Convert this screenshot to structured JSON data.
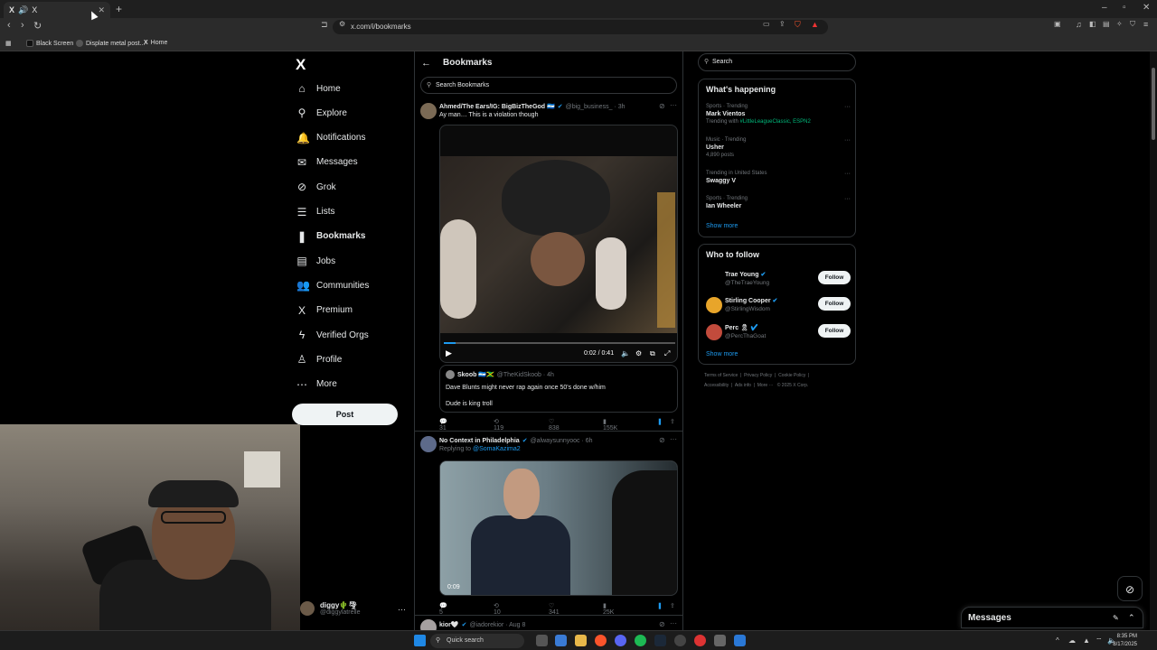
{
  "browser": {
    "tab_title": "X",
    "tab_icon": "X",
    "new_tab": "+",
    "url": "x.com/i/bookmarks",
    "bookmarks": [
      "Black Screen",
      "Displate metal post...",
      "Home"
    ]
  },
  "nav": {
    "logo": "X",
    "items": [
      {
        "label": "Home",
        "icon": "⌂"
      },
      {
        "label": "Explore",
        "icon": "⚲"
      },
      {
        "label": "Notifications",
        "icon": "🔔"
      },
      {
        "label": "Messages",
        "icon": "✉"
      },
      {
        "label": "Grok",
        "icon": "⊘"
      },
      {
        "label": "Lists",
        "icon": "☰"
      },
      {
        "label": "Bookmarks",
        "icon": "❚"
      },
      {
        "label": "Jobs",
        "icon": "▤"
      },
      {
        "label": "Communities",
        "icon": "👥"
      },
      {
        "label": "Premium",
        "icon": "X"
      },
      {
        "label": "Verified Orgs",
        "icon": "ϟ"
      },
      {
        "label": "Profile",
        "icon": "♙"
      },
      {
        "label": "More",
        "icon": "⋯"
      }
    ],
    "post_label": "Post",
    "account": {
      "name": "diggy🌵🌪",
      "handle": "@diggylatrelle",
      "more": "···"
    }
  },
  "center": {
    "title": "Bookmarks",
    "search_placeholder": "Search Bookmarks",
    "tweets": [
      {
        "name": "Ahmed/The Ears/IG: BigBizTheGod 🇳🇮",
        "handle": "@big_business_ · 3h",
        "text": "Ay man… This is a violation though",
        "video_time": "0:02 / 0:41",
        "quote": {
          "name": "Skoob 🇳🇮🇯🇲",
          "handle": "@TheKidSkoob · 4h",
          "text1": "Dave Blunts might never rap again once 50's done w/him",
          "text2": "Dude is king troll"
        },
        "replies": "31",
        "reposts": "119",
        "likes": "838",
        "views": "155K"
      },
      {
        "name": "No Context in Philadelphia",
        "handle": "@alwaysunnyooc · 6h",
        "replying": "Replying to",
        "replying_to": "@SomaKazima2",
        "video_time": "0:09",
        "replies": "5",
        "reposts": "10",
        "likes": "341",
        "views": "25K"
      },
      {
        "name": "kior🤍",
        "handle": "@iadorekior · Aug 8"
      }
    ]
  },
  "right": {
    "search_placeholder": "Search",
    "happening_title": "What's happening",
    "trends": [
      {
        "category": "Sports · Trending",
        "name": "Mark Vientos",
        "sub_prefix": "Trending with",
        "sub_link": "#LittleLeagueClassic, ESPN2"
      },
      {
        "category": "Music · Trending",
        "name": "Usher",
        "sub": "4,890 posts"
      },
      {
        "category": "Trending in United States",
        "name": "Swaggy V"
      },
      {
        "category": "Sports · Trending",
        "name": "Ian Wheeler"
      }
    ],
    "show_more": "Show more",
    "follow_title": "Who to follow",
    "follow": [
      {
        "name": "Trae Young",
        "handle": "@TheTraeYoung",
        "button": "Follow"
      },
      {
        "name": "Stirling Cooper",
        "handle": "@StirlingWisdom",
        "button": "Follow"
      },
      {
        "name": "Perc 🎗",
        "handle": "@PercThaGoat",
        "button": "Follow"
      }
    ],
    "footer": [
      "Terms of Service",
      "Privacy Policy",
      "Cookie Policy",
      "Accessibility",
      "Ads info",
      "More ···",
      "© 2025 X Corp."
    ]
  },
  "messages_drawer": {
    "title": "Messages"
  },
  "taskbar": {
    "search": "Quick search",
    "time": "8:35 PM",
    "date": "8/17/2025"
  },
  "colors": {
    "accent": "#1d9bf0",
    "bg": "#000000",
    "border": "#2f3336",
    "muted": "#71767b",
    "trend_link": "#00ba7c"
  }
}
